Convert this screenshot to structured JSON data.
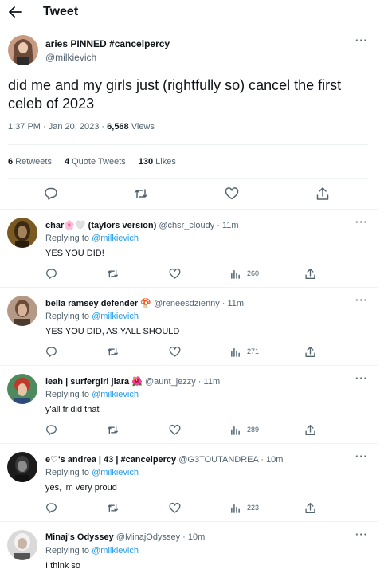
{
  "header": {
    "title": "Tweet",
    "back_icon": "arrow-left-icon"
  },
  "main_tweet": {
    "name": "aries PINNED #cancelpercy",
    "handle": "@milkievich",
    "text": "did me and my girls just (rightfully so) cancel the first celeb of 2023",
    "time": "1:37 PM · Jan 20, 2023 · ",
    "views_count": "6,568",
    "views_label": "Views",
    "retweets_count": "6",
    "retweets_label": "Retweets",
    "quotes_count": "4",
    "quotes_label": "Quote Tweets",
    "likes_count": "130",
    "likes_label": "Likes"
  },
  "colors": {
    "link": "#1d9bf0",
    "secondary": "#536471",
    "text": "#0f1419",
    "border": "#eff3f4"
  },
  "replies": [
    {
      "name": "char🌸🤍 (taylors version)",
      "handle": "@chsr_cloudy · 11m",
      "replying_prefix": "Replying to",
      "replying_to": "@milkievich",
      "text": "YES YOU DID!",
      "views": "260"
    },
    {
      "name": "bella ramsey defender 🍄",
      "handle": "@reneesdzienny · 11m",
      "replying_prefix": "Replying to",
      "replying_to": "@milkievich",
      "text": "YES YOU DID, AS YALL SHOULD",
      "views": "271"
    },
    {
      "name": "leah | surfergirl jiara 🌺",
      "handle": "@aunt_jezzy · 11m",
      "replying_prefix": "Replying to",
      "replying_to": "@milkievich",
      "text": "y'all fr did that",
      "views": "289"
    },
    {
      "name": "e♡'s andrea | 43 | #cancelpercy",
      "handle": "@G3TOUTANDREA · 10m",
      "replying_prefix": "Replying to",
      "replying_to": "@milkievich",
      "text": "yes, im very proud",
      "views": "223"
    },
    {
      "name": "Minaj's Odyssey",
      "handle": "@MinajOdyssey · 10m",
      "replying_prefix": "Replying to",
      "replying_to": "@milkievich",
      "text": "I think so",
      "views": ""
    }
  ]
}
